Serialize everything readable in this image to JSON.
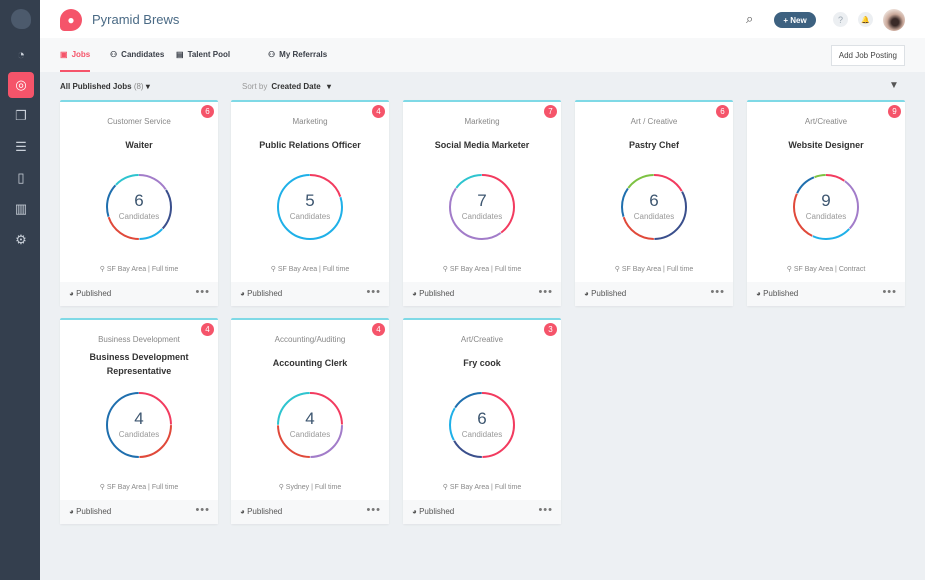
{
  "app": {
    "brand": "Pyramid Brews",
    "new_label": "+ New",
    "help": "?",
    "bell": "🔔"
  },
  "sidebar": {
    "items": [
      {
        "icon": "dashboard-icon",
        "glyph": "◔"
      },
      {
        "icon": "recruiting-icon",
        "glyph": "◎",
        "active": true
      },
      {
        "icon": "windows-icon",
        "glyph": "❐"
      },
      {
        "icon": "checklist-icon",
        "glyph": "☰"
      },
      {
        "icon": "book-icon",
        "glyph": "▯"
      },
      {
        "icon": "reports-icon",
        "glyph": "▥"
      },
      {
        "icon": "settings-icon",
        "glyph": "⚙"
      }
    ]
  },
  "tabs": [
    {
      "label": "Jobs",
      "icon": "briefcase-icon",
      "glyph": "▣",
      "active": true
    },
    {
      "label": "Candidates",
      "icon": "people-icon",
      "glyph": "⚇"
    },
    {
      "label": "Talent Pool",
      "icon": "calendar-icon",
      "glyph": "▤"
    },
    {
      "label": "My Referrals",
      "icon": "referrals-icon",
      "glyph": "⚇"
    }
  ],
  "add_job": "Add Job Posting",
  "filter": {
    "label": "All Published Jobs",
    "count": "(8)",
    "sort_label": "Sort by",
    "sort_value": "Created Date"
  },
  "colors": {
    "accent": "#f5546a",
    "pink": "#f23b5f",
    "blue": "#1fb0e8",
    "purple": "#a27cc9",
    "navy": "#3a4f8c",
    "darkblue": "#1f6fae",
    "red": "#e0493a",
    "teal": "#2ec4cf",
    "green": "#7dc242"
  },
  "jobs": [
    {
      "category": "Customer Service",
      "title": "Waiter",
      "badge": "6",
      "count": "6",
      "count_label": "Candidates",
      "location": "SF Bay Area | Full time",
      "status": "Published",
      "segments": [
        [
          "purple",
          0.16
        ],
        [
          "navy",
          0.21
        ],
        [
          "blue",
          0.13
        ],
        [
          "red",
          0.2
        ],
        [
          "darkblue",
          0.17
        ],
        [
          "teal",
          0.13
        ]
      ]
    },
    {
      "category": "Marketing",
      "title": "Public Relations Officer",
      "badge": "4",
      "count": "5",
      "count_label": "Candidates",
      "location": "SF Bay Area | Full time",
      "status": "Published",
      "segments": [
        [
          "pink",
          0.2
        ],
        [
          "blue",
          0.8
        ]
      ]
    },
    {
      "category": "Marketing",
      "title": "Social Media Marketer",
      "badge": "7",
      "count": "7",
      "count_label": "Candidates",
      "location": "SF Bay Area | Full time",
      "status": "Published",
      "segments": [
        [
          "pink",
          0.4
        ],
        [
          "purple",
          0.45
        ],
        [
          "teal",
          0.15
        ]
      ]
    },
    {
      "category": "Art / Creative",
      "title": "Pastry Chef",
      "badge": "6",
      "count": "6",
      "count_label": "Candidates",
      "location": "SF Bay Area | Full time",
      "status": "Published",
      "segments": [
        [
          "pink",
          0.17
        ],
        [
          "navy",
          0.33
        ],
        [
          "red",
          0.2
        ],
        [
          "darkblue",
          0.15
        ],
        [
          "green",
          0.15
        ]
      ]
    },
    {
      "category": "Art/Creative",
      "title": "Website Designer",
      "badge": "9",
      "count": "9",
      "count_label": "Candidates",
      "location": "SF Bay Area | Contract",
      "status": "Published",
      "segments": [
        [
          "pink",
          0.1
        ],
        [
          "purple",
          0.27
        ],
        [
          "blue",
          0.2
        ],
        [
          "red",
          0.25
        ],
        [
          "darkblue",
          0.12
        ],
        [
          "green",
          0.06
        ]
      ]
    },
    {
      "category": "Business Development",
      "title": "Business Development Representative",
      "badge": "4",
      "count": "4",
      "count_label": "Candidates",
      "location": "SF Bay Area | Full time",
      "status": "Published",
      "segments": [
        [
          "pink",
          0.25
        ],
        [
          "red",
          0.25
        ],
        [
          "darkblue",
          0.5
        ]
      ]
    },
    {
      "category": "Accounting/Auditing",
      "title": "Accounting Clerk",
      "badge": "4",
      "count": "4",
      "count_label": "Candidates",
      "location": "Sydney | Full time",
      "status": "Published",
      "segments": [
        [
          "pink",
          0.25
        ],
        [
          "purple",
          0.25
        ],
        [
          "red",
          0.25
        ],
        [
          "teal",
          0.25
        ]
      ]
    },
    {
      "category": "Art/Creative",
      "title": "Fry cook",
      "badge": "3",
      "count": "6",
      "count_label": "Candidates",
      "location": "SF Bay Area | Full time",
      "status": "Published",
      "segments": [
        [
          "pink",
          0.5
        ],
        [
          "navy",
          0.17
        ],
        [
          "blue",
          0.17
        ],
        [
          "darkblue",
          0.16
        ]
      ]
    }
  ]
}
